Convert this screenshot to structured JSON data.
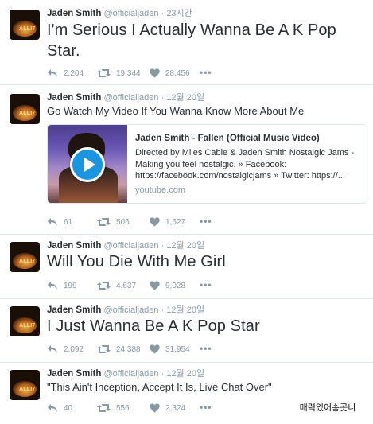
{
  "tweets": [
    {
      "author": "Jaden Smith",
      "handle": "@officialjaden",
      "separator": "·",
      "time": "23시간",
      "text": "I'm Serious I Actually Wanna Be A K Pop",
      "text_line2": "Star.",
      "replies": "2,204",
      "retweets": "19,344",
      "likes": "28,456"
    },
    {
      "author": "Jaden Smith",
      "handle": "@officialjaden",
      "separator": "·",
      "time": "12월 20일",
      "text": "Go Watch My Video If You Wanna Know More About Me",
      "card": {
        "title": "Jaden Smith - Fallen (Official Music Video)",
        "desc_line1": "Directed by Miles Cable & Jaden Smith Nostalgic Jams -",
        "desc_line2": "Making you feel nostalgic. » Facebook:",
        "desc_line3": "https://facebook.com/nostalgicjams » Twitter: https://...",
        "domain": "youtube.com"
      },
      "replies": "61",
      "retweets": "506",
      "likes": "1,627"
    },
    {
      "author": "Jaden Smith",
      "handle": "@officialjaden",
      "separator": "·",
      "time": "12월 20일",
      "text": "Will You Die With Me Girl",
      "replies": "199",
      "retweets": "4,637",
      "likes": "9,028"
    },
    {
      "author": "Jaden Smith",
      "handle": "@officialjaden",
      "separator": "·",
      "time": "12월 20일",
      "text": "I Just Wanna Be A K Pop Star",
      "replies": "2,092",
      "retweets": "24,388",
      "likes": "31,954"
    },
    {
      "author": "Jaden Smith",
      "handle": "@officialjaden",
      "separator": "·",
      "time": "12월 20일",
      "text": "\"This Ain't Inception, Accept It Is, Live Chat Over\"",
      "replies": "40",
      "retweets": "556",
      "likes": "2,324"
    }
  ],
  "avatar_text": "ALLI7",
  "more_label": "•••",
  "icons": {
    "reply": "reply-icon",
    "retweet": "retweet-icon",
    "like": "heart-icon",
    "more": "more-dots-icon"
  },
  "colors": {
    "text": "#292f33",
    "muted": "#8899a6",
    "divider": "#e1e8ed",
    "play": "#1b95e0"
  },
  "watermark": "매력있어송곳니"
}
